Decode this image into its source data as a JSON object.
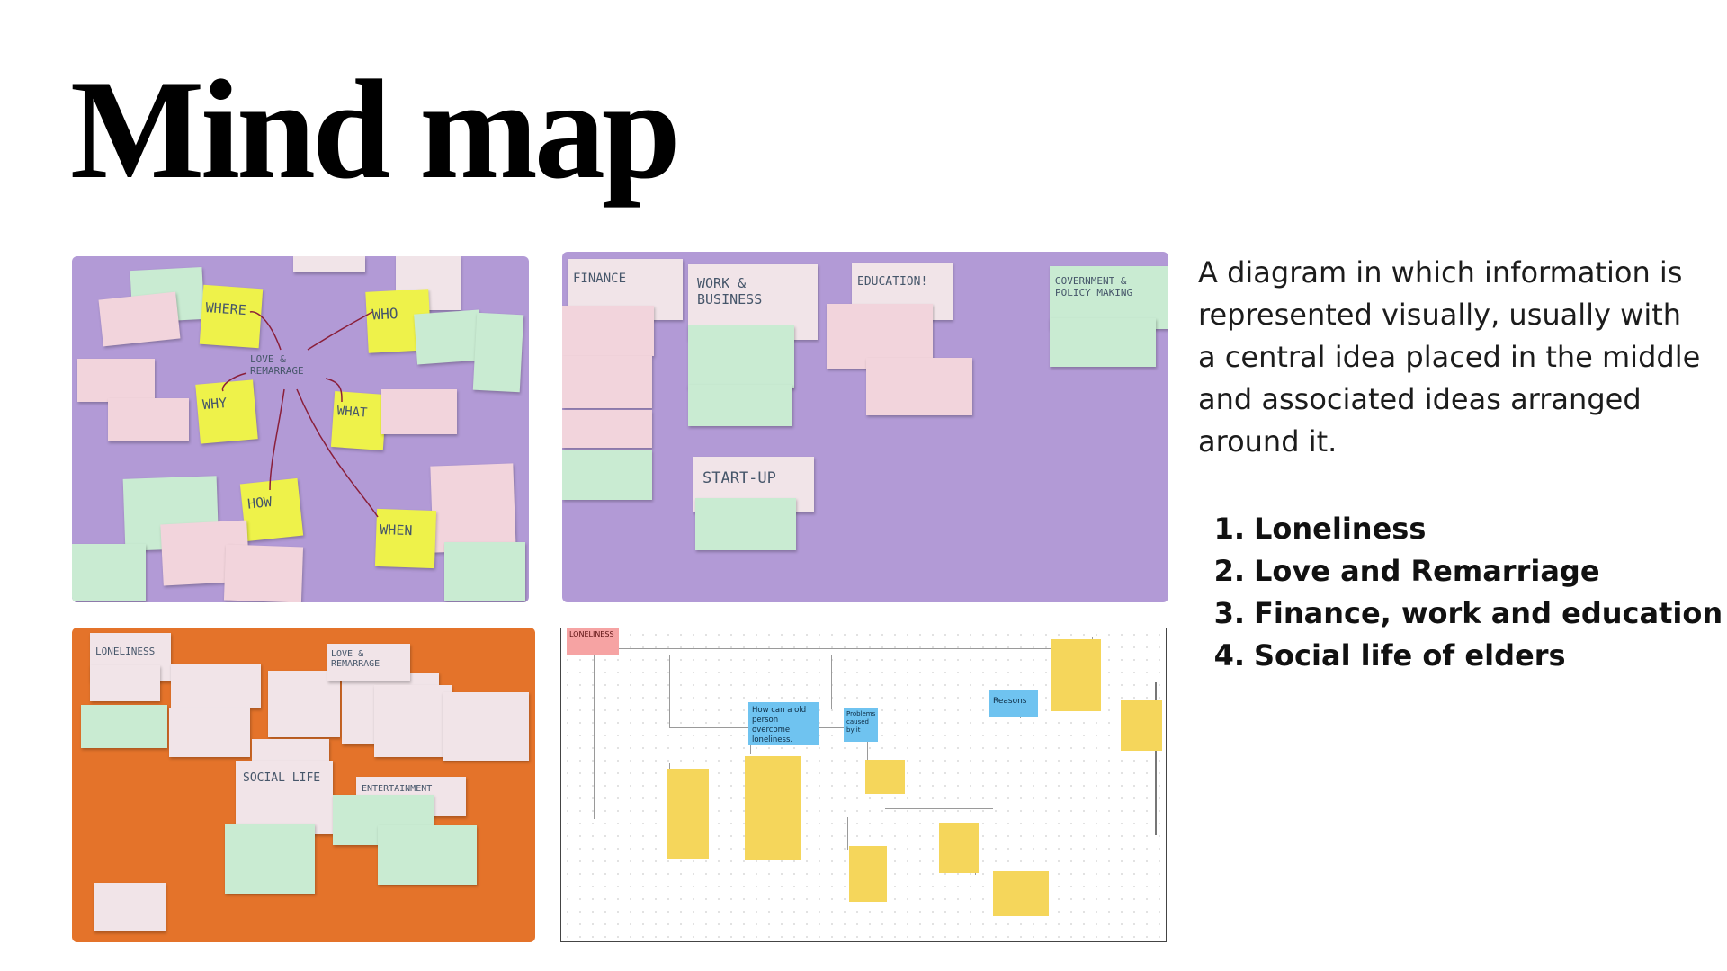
{
  "slide": {
    "title": "Mind map",
    "description": "A diagram in which information is represented visually, usually with a central idea placed in the middle and associated ideas arranged around it.",
    "list": [
      {
        "num": "1.",
        "text": "Loneliness"
      },
      {
        "num": "2.",
        "text": "Love and Remarriage"
      },
      {
        "num": "3.",
        "text": "Finance, work and education"
      },
      {
        "num": "4.",
        "text": "Social life of elders"
      }
    ]
  },
  "board1": {
    "center": "LOVE & REMARRAGE",
    "where": "WHERE",
    "who": "WHO",
    "why": "WHY",
    "what": "WHAT",
    "how": "HOW",
    "when": "WHEN"
  },
  "board2": {
    "finance": "FINANCE",
    "work": "WORK & BUSINESS",
    "education": "EDUCATION!",
    "government": "GOVERNMENT & POLICY MAKING",
    "startup": "START-UP"
  },
  "board3": {
    "loneliness": "LONELINESS",
    "love": "LOVE & REMARRAGE",
    "social": "SOCIAL LIFE",
    "entertainment": "ENTERTAINMENT"
  },
  "board4": {
    "loneliness": "LONELINESS",
    "overcome": "How can a old person overcome loneliness.",
    "problems": "Problems caused by it",
    "reasons": "Reasons"
  },
  "colors": {
    "purple_board": "#b29ad6",
    "orange_board": "#e4732a",
    "blue_node": "#6fc3f0",
    "yellow_sticky": "#f5d65b",
    "pink_node": "#f6a3a3"
  }
}
